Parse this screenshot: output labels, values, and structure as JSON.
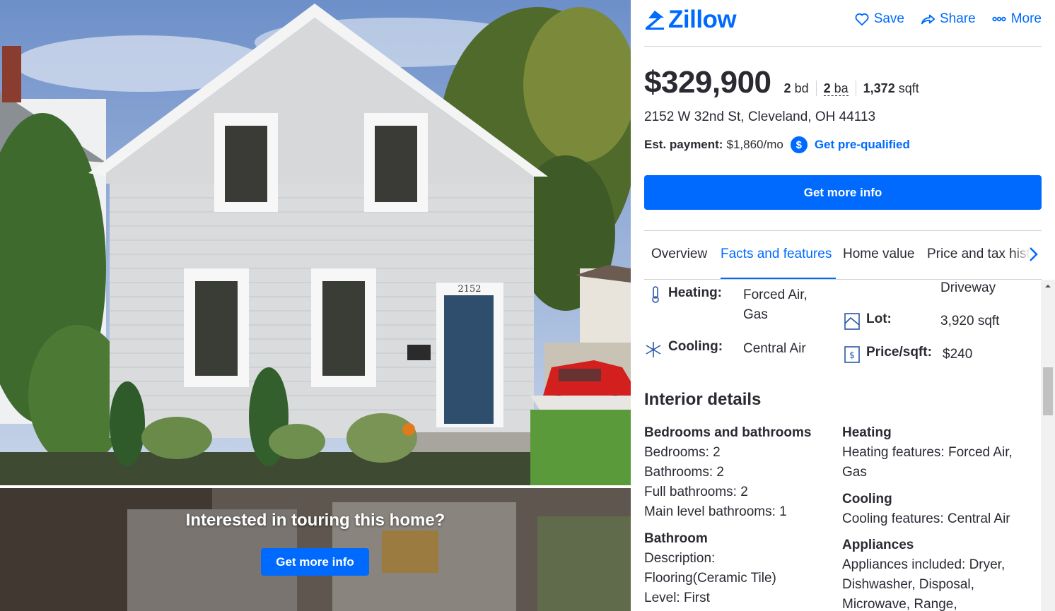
{
  "listing_photo": {
    "house_number": "2152"
  },
  "tour_banner": {
    "title": "Interested in touring this home?",
    "button_label": "Get more info"
  },
  "header": {
    "brand": "Zillow",
    "save_label": "Save",
    "share_label": "Share",
    "more_label": "More"
  },
  "summary": {
    "price": "$329,900",
    "beds_num": "2",
    "beds_unit": "bd",
    "baths_num": "2",
    "baths_unit": "ba",
    "sqft_num": "1,372",
    "sqft_unit": "sqft",
    "address": "2152 W 32nd St, Cleveland, OH 44113",
    "est_label": "Est. payment:",
    "est_value": "$1,860/mo",
    "prequal_link": "Get pre-qualified",
    "cta_label": "Get more info"
  },
  "tabs": [
    {
      "label": "Overview"
    },
    {
      "label": "Facts and features"
    },
    {
      "label": "Home value"
    },
    {
      "label": "Price and tax hist"
    }
  ],
  "facts": {
    "heating_label": "Heating:",
    "heating_value_1": "Forced Air,",
    "heating_value_2": "Gas",
    "cooling_label": "Cooling:",
    "cooling_value": "Central Air",
    "parking_value": "Driveway",
    "lot_label": "Lot:",
    "lot_value": "3,920 sqft",
    "ppsf_label": "Price/sqft:",
    "ppsf_value": "$240"
  },
  "interior": {
    "heading": "Interior details",
    "bed_bath_heading": "Bedrooms and bathrooms",
    "bedrooms": "Bedrooms: 2",
    "bathrooms": "Bathrooms: 2",
    "full_baths": "Full bathrooms: 2",
    "main_level_baths": "Main level bathrooms: 1",
    "bathroom_heading": "Bathroom",
    "bathroom_desc": "Description:",
    "bathroom_floor": "Flooring(Ceramic Tile)",
    "bathroom_level": "Level: First",
    "heating_heading": "Heating",
    "heating_features_1": "Heating features: Forced Air,",
    "heating_features_2": "Gas",
    "cooling_heading": "Cooling",
    "cooling_features": "Cooling features: Central Air",
    "appliances_heading": "Appliances",
    "appliances_1": "Appliances included: Dryer,",
    "appliances_2": "Dishwasher, Disposal,",
    "appliances_3": "Microwave, Range,"
  },
  "colors": {
    "brand_blue": "#006aff",
    "text": "#2a2a33",
    "divider": "#d1d1d5"
  },
  "icons": [
    "zillow-logo-icon",
    "heart-icon",
    "share-icon",
    "more-dots-icon",
    "dollar-icon",
    "chevron-right-icon",
    "thermometer-icon",
    "snowflake-icon",
    "lot-icon",
    "price-per-sqft-icon"
  ]
}
